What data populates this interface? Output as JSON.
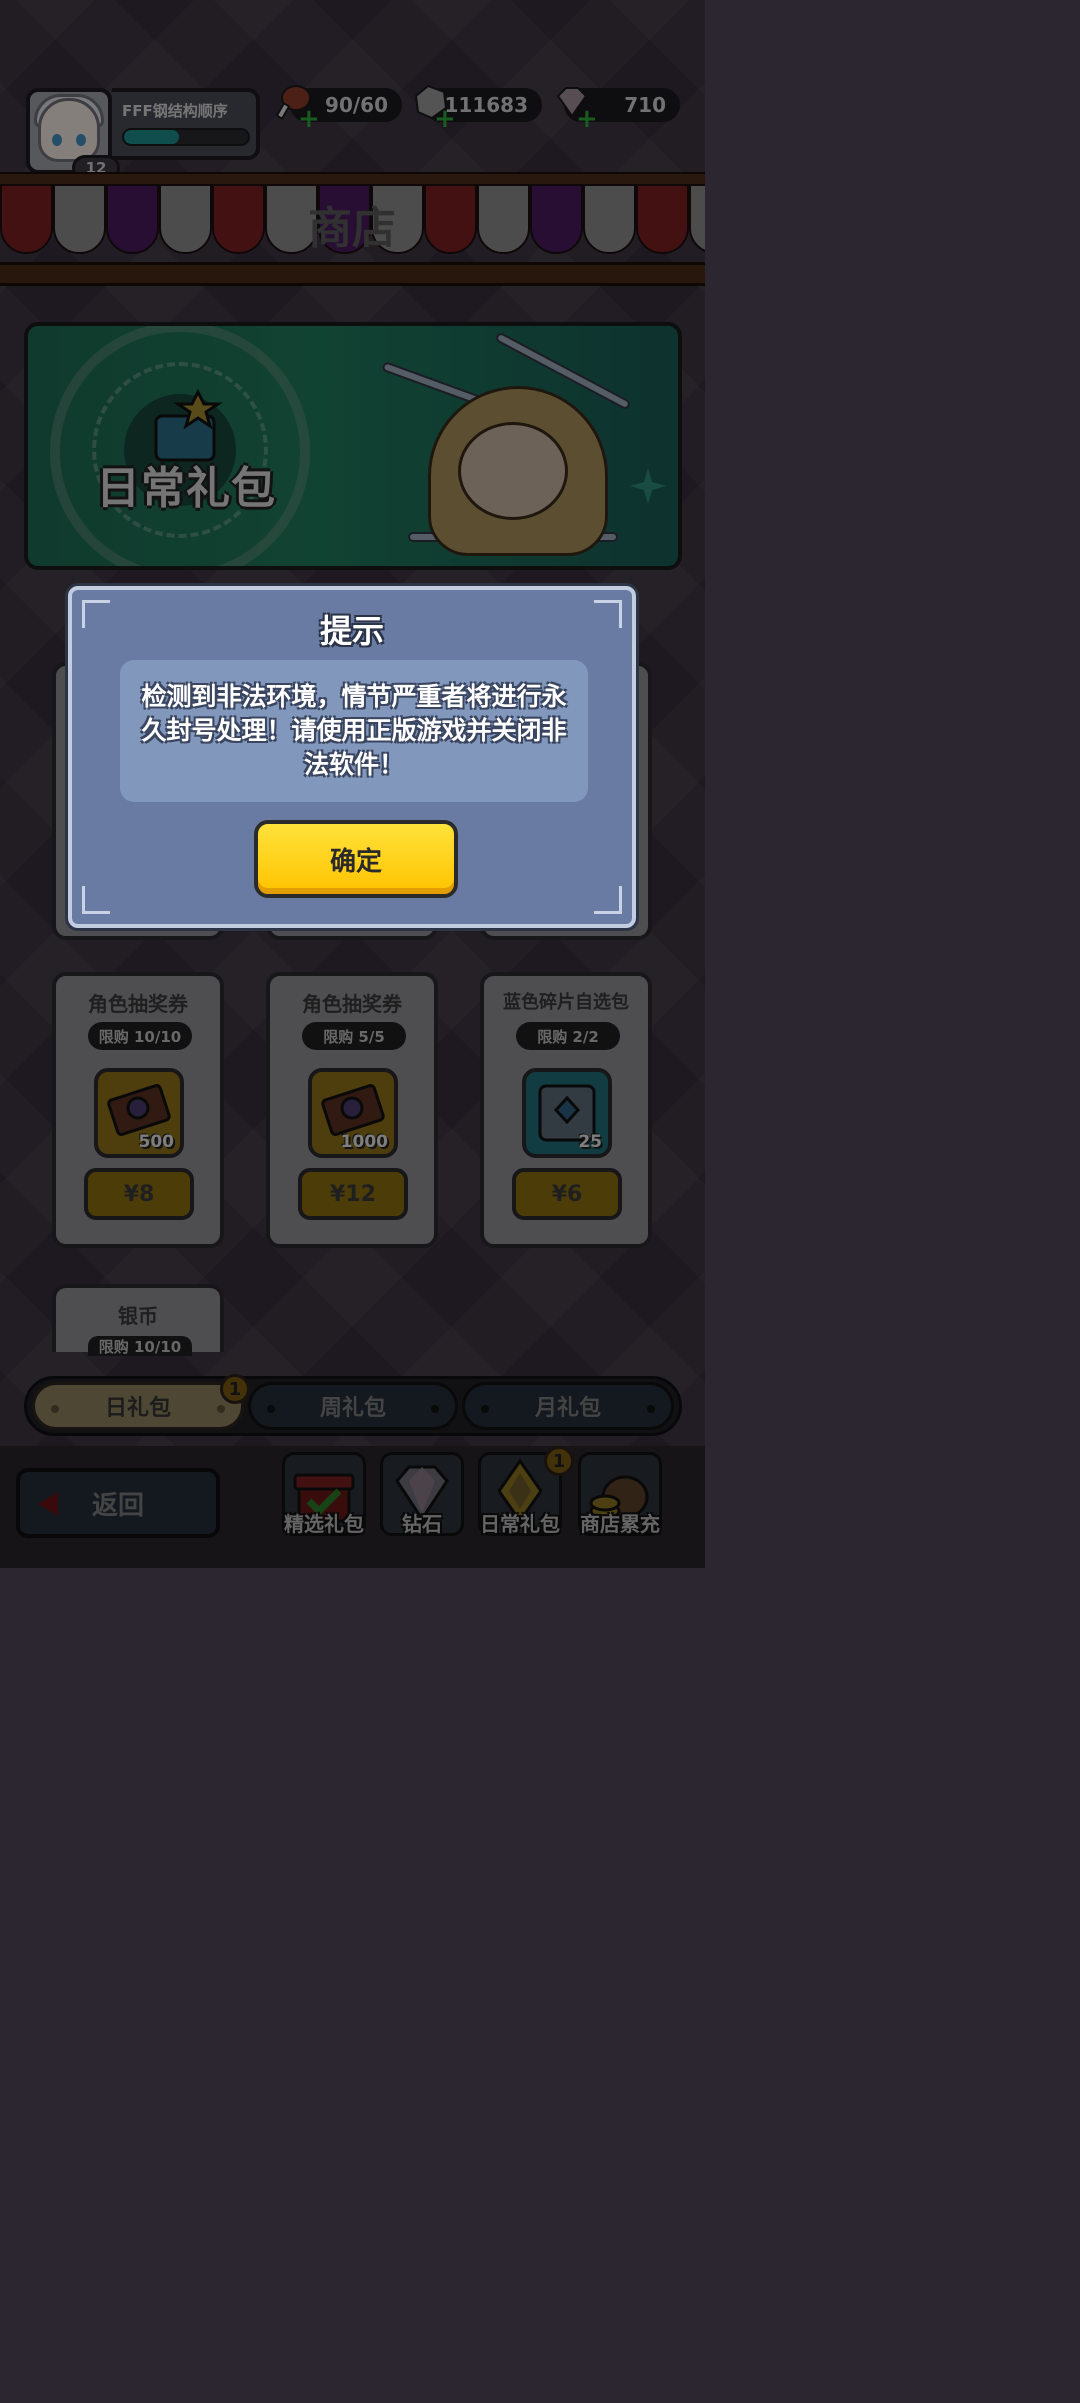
{
  "player": {
    "name": "FFF钢结构顺序",
    "level": "12",
    "xp_fraction": 0.44
  },
  "resources": {
    "stamina": "90/60",
    "stone": "111683",
    "diamond": "710"
  },
  "header": {
    "title": "商店"
  },
  "banner": {
    "title": "日常礼包"
  },
  "cards": [
    {
      "title": "角色抽奖券",
      "limit": "限购 10/10",
      "qty": "500",
      "price": "¥8",
      "icon": "ticket-icon"
    },
    {
      "title": "角色抽奖券",
      "limit": "限购 5/5",
      "qty": "1000",
      "price": "¥12",
      "icon": "ticket-icon"
    },
    {
      "title": "蓝色碎片自选包",
      "limit": "限购 2/2",
      "qty": "25",
      "price": "¥6",
      "icon": "shard-pack-icon"
    },
    {
      "title": "银币",
      "limit": "限购 10/10"
    }
  ],
  "tabs": {
    "daily": "日礼包",
    "weekly": "周礼包",
    "monthly": "月礼包",
    "daily_badge": "1"
  },
  "bottom_nav": {
    "back": "返回",
    "items": [
      {
        "label": "精选礼包",
        "icon": "gift-icon"
      },
      {
        "label": "钻石",
        "icon": "diamond-icon"
      },
      {
        "label": "日常礼包",
        "icon": "daily-pack-icon",
        "badge": "1"
      },
      {
        "label": "商店累充",
        "icon": "coin-bag-icon"
      }
    ]
  },
  "dialog": {
    "title": "提示",
    "message": "检测到非法环境，情节严重者将进行永久封号处理！请使用正版游戏并关闭非法软件！",
    "confirm": "确定"
  },
  "colors": {
    "confirm_button": "#ffd21a",
    "dialog_bg": "#6a7ba3",
    "message_bg": "#8197bb"
  }
}
